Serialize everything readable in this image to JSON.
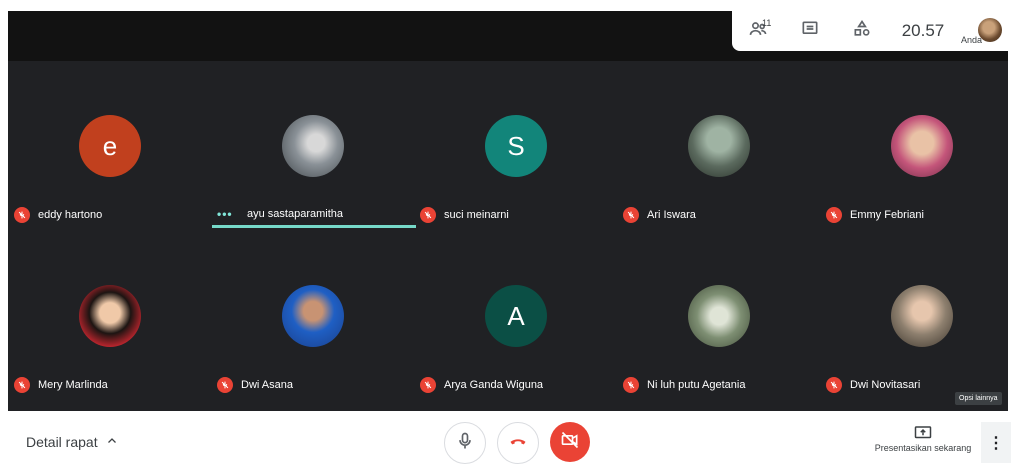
{
  "topbar": {
    "people_count": "11",
    "clock": "20.57",
    "self_label": "Anda"
  },
  "participants": [
    {
      "name": "eddy hartono",
      "initial": "e",
      "color": "#c1401e",
      "muted": true
    },
    {
      "name": "ayu sastaparamitha",
      "initial": "",
      "color": "#8a9197",
      "muted": false,
      "speaking": true
    },
    {
      "name": "suci meinarni",
      "initial": "S",
      "color": "#12857a",
      "muted": true
    },
    {
      "name": "Ari Iswara",
      "initial": "",
      "color": "#5b6a5e",
      "muted": true
    },
    {
      "name": "Emmy Febriani",
      "initial": "",
      "color": "#b46a7a",
      "muted": true
    },
    {
      "name": "Mery Marlinda",
      "initial": "",
      "color": "#c3262f",
      "muted": true
    },
    {
      "name": "Dwi Asana",
      "initial": "",
      "color": "#1f5fc4",
      "muted": true
    },
    {
      "name": "Arya Ganda Wiguna",
      "initial": "A",
      "color": "#0b4f45",
      "muted": true
    },
    {
      "name": "Ni luh putu Agetania",
      "initial": "",
      "color": "#7e8f73",
      "muted": true
    },
    {
      "name": "Dwi Novitasari",
      "initial": "",
      "color": "#8d7f6e",
      "muted": true
    }
  ],
  "tooltip": "Opsi lainnya",
  "bottom": {
    "details_label": "Detail rapat",
    "present_label": "Presentasikan sekarang",
    "more_label": "⋮"
  },
  "colors": {
    "stage": "#202124",
    "muted_red": "#ea4335",
    "speaking_teal": "#76d9c9"
  }
}
